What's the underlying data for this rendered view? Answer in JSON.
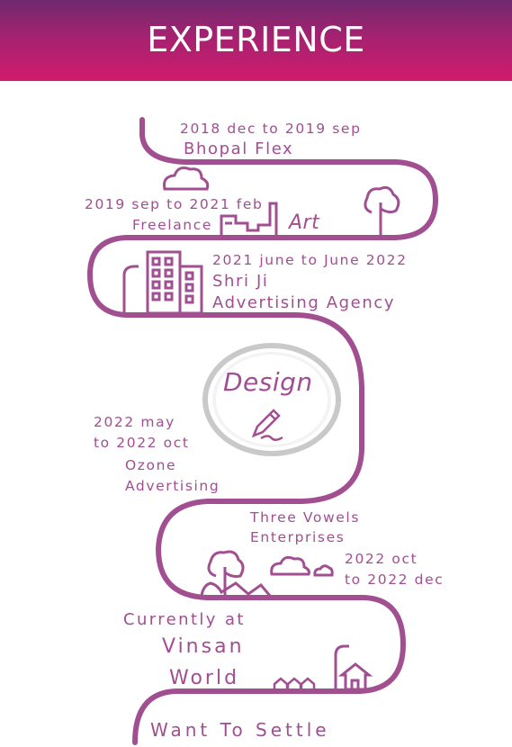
{
  "header": {
    "title": "EXPERIENCE"
  },
  "timeline": [
    {
      "period": "2018 dec to 2019 sep",
      "company": "Bhopal Flex"
    },
    {
      "period": "2019 sep to 2021 feb",
      "company": "Freelance"
    },
    {
      "period": "2021 june to June 2022",
      "company_line1": "Shri Ji",
      "company_line2": "Advertising Agency"
    },
    {
      "period_line1": "2022 may",
      "period_line2": "to 2022 oct",
      "company_line1": "Ozone",
      "company_line2": "Advertising"
    },
    {
      "company_line1": "Three Vowels",
      "company_line2": "Enterprises",
      "period_line1": "2022 oct",
      "period_line2": "to 2022 dec"
    },
    {
      "prefix": "Currently at",
      "company_line1": "Vinsan",
      "company_line2": "World"
    }
  ],
  "labels": {
    "art": "Art",
    "design": "Design",
    "goal": "Want To Settle"
  },
  "colors": {
    "road": "#a24f92",
    "header_top": "#6e2a6e",
    "header_bottom": "#d21b6d",
    "text": "#a14e92"
  },
  "icons": [
    "cloud-icon",
    "factory-icon",
    "tree-icon",
    "building-icon",
    "street-lamp-icon",
    "pencil-icon",
    "hills-icon",
    "house-icon",
    "small-houses-icon"
  ]
}
